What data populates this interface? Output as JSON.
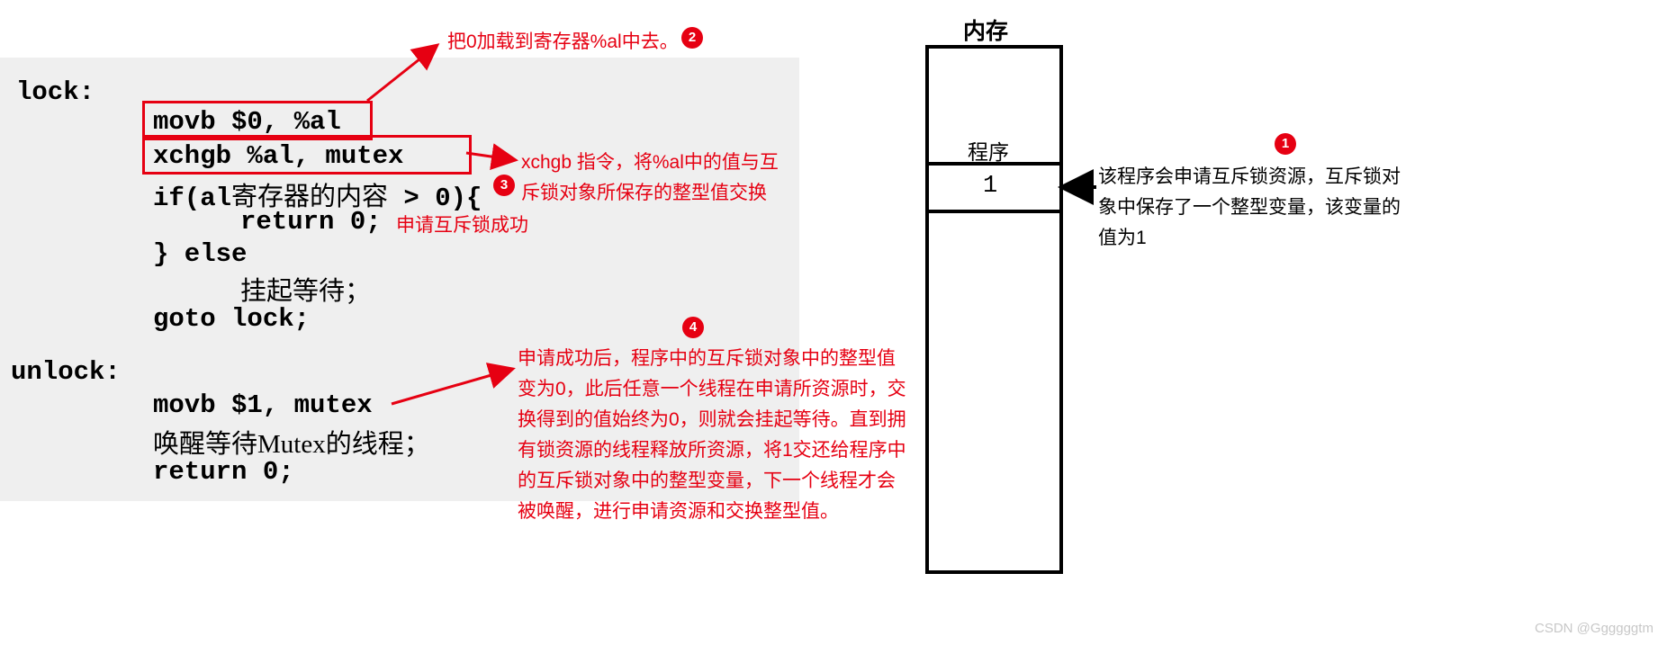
{
  "code": {
    "lock_label": "lock:",
    "movb0": "movb $0, %al",
    "xchgb": "xchgb %al, mutex",
    "if_cn_pre": "if(al",
    "if_cn_text": "寄存器的内容",
    "if_cn_post": " > 0){",
    "return0_a": "return 0;",
    "else_brace": "} else",
    "suspend": "挂起等待；",
    "goto": "goto lock;",
    "unlock_label": "unlock:",
    "movb1": "movb $1, mutex",
    "wake_cn": "唤醒等待Mutex的线程；",
    "return0_b": "return 0;"
  },
  "anno": {
    "a2": "把0加载到寄存器%al中去。",
    "a3a": "xchgb 指令，将%al中的值与互",
    "a3b": "斥锁对象所保存的整型值交换",
    "success": "申请互斥锁成功",
    "a4_1": "申请成功后，程序中的互斥锁对象中的整型值",
    "a4_2": "变为0，此后任意一个线程在申请所资源时，交",
    "a4_3": "换得到的值始终为0，则就会挂起等待。直到拥",
    "a4_4": "有锁资源的线程释放所资源，将1交还给程序中",
    "a4_5": "的互斥锁对象中的整型变量，下一个线程才会",
    "a4_6": "被唤醒，进行申请资源和交换整型值。",
    "r1_1": "该程序会申请互斥锁资源，互斥锁对",
    "r1_2": "象中保存了一个整型变量，该变量的",
    "r1_3": "值为1"
  },
  "mem": {
    "title": "内存",
    "prog": "程序",
    "val": "1"
  },
  "watermark": "CSDN @Ggggggtm"
}
